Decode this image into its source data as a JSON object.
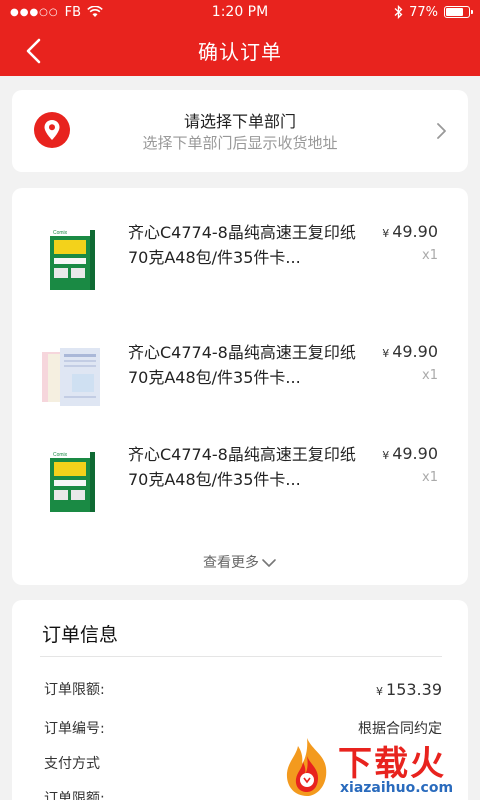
{
  "status_bar": {
    "carrier": "FB",
    "time": "1:20 PM",
    "battery": "77%",
    "battery_level": 0.77
  },
  "nav": {
    "title": "确认订单",
    "back_icon": "chevron-left-icon"
  },
  "address": {
    "icon": "location-pin-icon",
    "title": "请选择下单部门",
    "subtitle": "选择下单部门后显示收货地址"
  },
  "goods": {
    "items": [
      {
        "name": "齐心C4774-8晶纯高速王复印纸70克A48包/件35件卡...",
        "price": "49.90",
        "qty": "x1",
        "thumb": "green-paper-box"
      },
      {
        "name": "齐心C4774-8晶纯高速王复印纸70克A48包/件35件卡...",
        "price": "49.90",
        "qty": "x1",
        "thumb": "form-paper-sheets"
      },
      {
        "name": "齐心C4774-8晶纯高速王复印纸70克A48包/件35件卡...",
        "price": "49.90",
        "qty": "x1",
        "thumb": "green-paper-box"
      }
    ],
    "currency": "¥",
    "more_label": "查看更多"
  },
  "order_info": {
    "title": "订单信息",
    "rows": [
      {
        "label": "订单限额:",
        "value": "153.39",
        "currency": "¥"
      },
      {
        "label": "订单编号:",
        "value": "根据合同约定"
      },
      {
        "label": "支付方式",
        "value": ""
      },
      {
        "label": "订单限额:",
        "value": ""
      }
    ]
  },
  "watermark": {
    "text": "下载火",
    "url": "xiazaihuo.com"
  },
  "colors": {
    "brand_red": "#e8231e",
    "background": "#f2f2f2"
  }
}
